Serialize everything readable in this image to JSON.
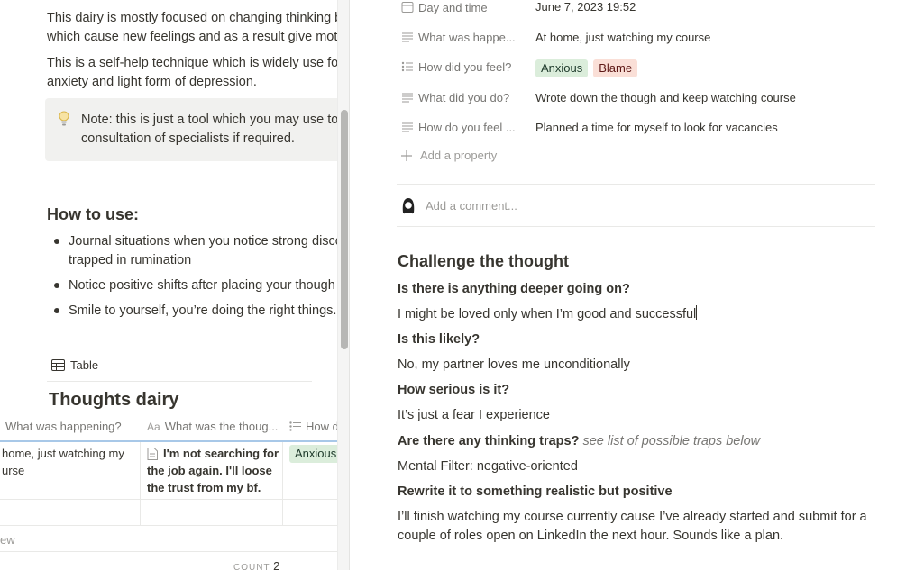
{
  "left": {
    "intro": [
      "This dairy is mostly focused on changing thinking be",
      "which cause new feelings and as a result give motiva",
      "This is a self-help technique which is widely use for s",
      "anxiety and light form of depression."
    ],
    "callout": {
      "icon": "lightbulb-icon",
      "lines": [
        "Note: this is just a tool which you may use to h",
        "consultation of specialists if required."
      ]
    },
    "how_to_use": {
      "title": "How to use:",
      "bullets": [
        [
          "Journal situations when you notice strong disco",
          "trapped in rumination"
        ],
        [
          "Notice positive shifts after placing your though"
        ],
        [
          "Smile to yourself, you’re doing the right things. N"
        ]
      ]
    },
    "table": {
      "view_label": "Table",
      "title": "Thoughts dairy",
      "columns": [
        "What was happening?",
        "What was the thoug...",
        "How did"
      ],
      "rows": [
        {
          "happening": [
            "home, just watching my",
            "urse"
          ],
          "thought": [
            "I'm not searching for",
            "the job again. I'll loose",
            "the trust from my bf."
          ],
          "feeling_tag": "Anxious"
        }
      ],
      "new_row_label": "ew",
      "count_label": "COUNT",
      "count_value": "2"
    }
  },
  "properties": [
    {
      "icon": "calendar-icon",
      "label": "Day and time",
      "value": "June 7, 2023 19:52"
    },
    {
      "icon": "text-icon",
      "label": "What was happe...",
      "value": "At home, just watching my course"
    },
    {
      "icon": "multiselect-icon",
      "label": "How did you feel?",
      "tags": [
        "Anxious",
        "Blame"
      ]
    },
    {
      "icon": "text-icon",
      "label": "What did you do?",
      "value": "Wrote down the though and keep watching course"
    },
    {
      "icon": "text-icon",
      "label": "How do you feel ...",
      "value": "Planned a time for myself to look for vacancies"
    }
  ],
  "add_property": "Add a property",
  "comment_placeholder": "Add a comment...",
  "challenge": {
    "title": "Challenge the thought",
    "q1": "Is there is anything deeper going on?",
    "a1": "I might be loved only when I’m good and successful",
    "q2": "Is this likely?",
    "a2": "No, my partner loves me unconditionally",
    "q3": "How serious is it?",
    "a3": "It’s just a fear I experience",
    "q4": "Are there any thinking traps?",
    "q4_hint": "see list of possible traps below",
    "a4": "Mental Filter: negative-oriented",
    "q5": "Rewrite it to something realistic but positive",
    "a5_line1": "I’ll finish watching my course currently cause I’ve already started and submit for a",
    "a5_line2": "couple of roles open on LinkedIn the next hour. Sounds like a plan."
  }
}
